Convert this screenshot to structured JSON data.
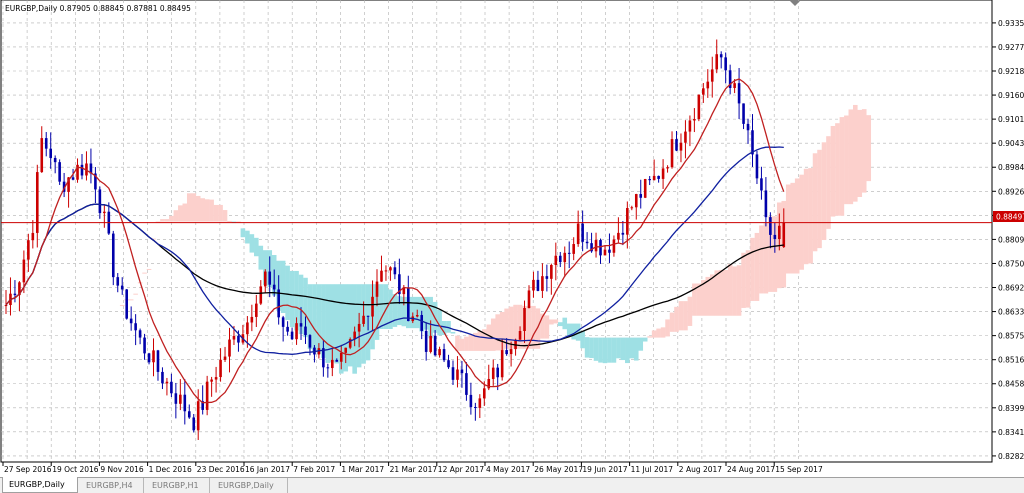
{
  "chart_header": "EURGBP,Daily  0.87905 0.88845 0.87881 0.88495",
  "current_price": "0.88497",
  "price_axis_labels": [
    "0.93355",
    "0.92770",
    "0.92185",
    "0.91600",
    "0.91015",
    "0.90430",
    "0.89845",
    "0.89260",
    "0.88675",
    "0.88090",
    "0.87505",
    "0.86920",
    "0.86335",
    "0.85750",
    "0.85165",
    "0.84580",
    "0.83995",
    "0.83410",
    "0.82825"
  ],
  "date_axis_labels": [
    "27 Sep 2016",
    "19 Oct 2016",
    "9 Nov 2016",
    "1 Dec 2016",
    "23 Dec 2016",
    "16 Jan 2017",
    "7 Feb 2017",
    "1 Mar 2017",
    "21 Mar 2017",
    "12 Apr 2017",
    "4 May 2017",
    "26 May 2017",
    "19 Jun 2017",
    "11 Jul 2017",
    "2 Aug 2017",
    "24 Aug 2017",
    "15 Sep 2017"
  ],
  "tabs": [
    {
      "label": "EURGBP,Daily",
      "active": true
    },
    {
      "label": "EURGBP,H4",
      "active": false
    },
    {
      "label": "EURGBP,H1",
      "active": false
    },
    {
      "label": "EURGBP,Daily",
      "active": false
    }
  ],
  "colors": {
    "bull_candle": "#cc0000",
    "bear_candle": "#0000aa",
    "grid": "#b0b0b0",
    "price_line": "#cc0000",
    "ma_red": "#c02020",
    "ma_blue": "#1020a0",
    "ma_black": "#000000",
    "cloud_bull": "#fcd0cc",
    "cloud_bear": "#9ee0e4"
  },
  "chart_data": {
    "type": "candlestick",
    "symbol": "EURGBP",
    "timeframe": "Daily",
    "ylim": [
      0.8275,
      0.9362
    ],
    "last_ohlc": {
      "open": 0.87905,
      "high": 0.88845,
      "low": 0.87881,
      "close": 0.88495
    },
    "x_ticks": [
      "27 Sep 2016",
      "19 Oct 2016",
      "9 Nov 2016",
      "1 Dec 2016",
      "23 Dec 2016",
      "16 Jan 2017",
      "7 Feb 2017",
      "1 Mar 2017",
      "21 Mar 2017",
      "12 Apr 2017",
      "4 May 2017",
      "26 May 2017",
      "19 Jun 2017",
      "11 Jul 2017",
      "2 Aug 2017",
      "24 Aug 2017",
      "15 Sep 2017"
    ],
    "close_path": [
      [
        0,
        0.865
      ],
      [
        3,
        0.872
      ],
      [
        6,
        0.885
      ],
      [
        8,
        0.905
      ],
      [
        10,
        0.902
      ],
      [
        12,
        0.894
      ],
      [
        14,
        0.896
      ],
      [
        16,
        0.898
      ],
      [
        18,
        0.899
      ],
      [
        20,
        0.895
      ],
      [
        22,
        0.885
      ],
      [
        24,
        0.874
      ],
      [
        26,
        0.866
      ],
      [
        28,
        0.861
      ],
      [
        30,
        0.856
      ],
      [
        32,
        0.853
      ],
      [
        34,
        0.849
      ],
      [
        36,
        0.846
      ],
      [
        38,
        0.843
      ],
      [
        40,
        0.84
      ],
      [
        42,
        0.837
      ],
      [
        44,
        0.841
      ],
      [
        46,
        0.847
      ],
      [
        48,
        0.851
      ],
      [
        50,
        0.855
      ],
      [
        52,
        0.858
      ],
      [
        54,
        0.861
      ],
      [
        56,
        0.868
      ],
      [
        58,
        0.872
      ],
      [
        60,
        0.866
      ],
      [
        62,
        0.86
      ],
      [
        64,
        0.857
      ],
      [
        66,
        0.86
      ],
      [
        68,
        0.856
      ],
      [
        70,
        0.853
      ],
      [
        72,
        0.851
      ],
      [
        74,
        0.849
      ],
      [
        76,
        0.852
      ],
      [
        78,
        0.857
      ],
      [
        80,
        0.862
      ],
      [
        82,
        0.868
      ],
      [
        84,
        0.875
      ],
      [
        86,
        0.873
      ],
      [
        88,
        0.869
      ],
      [
        90,
        0.864
      ],
      [
        92,
        0.862
      ],
      [
        94,
        0.856
      ],
      [
        96,
        0.853
      ],
      [
        98,
        0.851
      ],
      [
        100,
        0.849
      ],
      [
        102,
        0.846
      ],
      [
        104,
        0.843
      ],
      [
        106,
        0.841
      ],
      [
        108,
        0.846
      ],
      [
        110,
        0.849
      ],
      [
        112,
        0.855
      ],
      [
        114,
        0.859
      ],
      [
        116,
        0.864
      ],
      [
        118,
        0.869
      ],
      [
        120,
        0.872
      ],
      [
        122,
        0.876
      ],
      [
        124,
        0.878
      ],
      [
        126,
        0.879
      ],
      [
        128,
        0.883
      ],
      [
        130,
        0.882
      ],
      [
        132,
        0.88
      ],
      [
        134,
        0.879
      ],
      [
        136,
        0.881
      ],
      [
        138,
        0.885
      ],
      [
        140,
        0.889
      ],
      [
        142,
        0.892
      ],
      [
        144,
        0.894
      ],
      [
        146,
        0.897
      ],
      [
        148,
        0.901
      ],
      [
        150,
        0.905
      ],
      [
        152,
        0.909
      ],
      [
        154,
        0.913
      ],
      [
        156,
        0.918
      ],
      [
        158,
        0.922
      ],
      [
        160,
        0.925
      ],
      [
        162,
        0.92
      ],
      [
        164,
        0.913
      ],
      [
        166,
        0.905
      ],
      [
        168,
        0.896
      ],
      [
        170,
        0.884
      ],
      [
        172,
        0.881
      ],
      [
        174,
        0.885
      ]
    ]
  }
}
